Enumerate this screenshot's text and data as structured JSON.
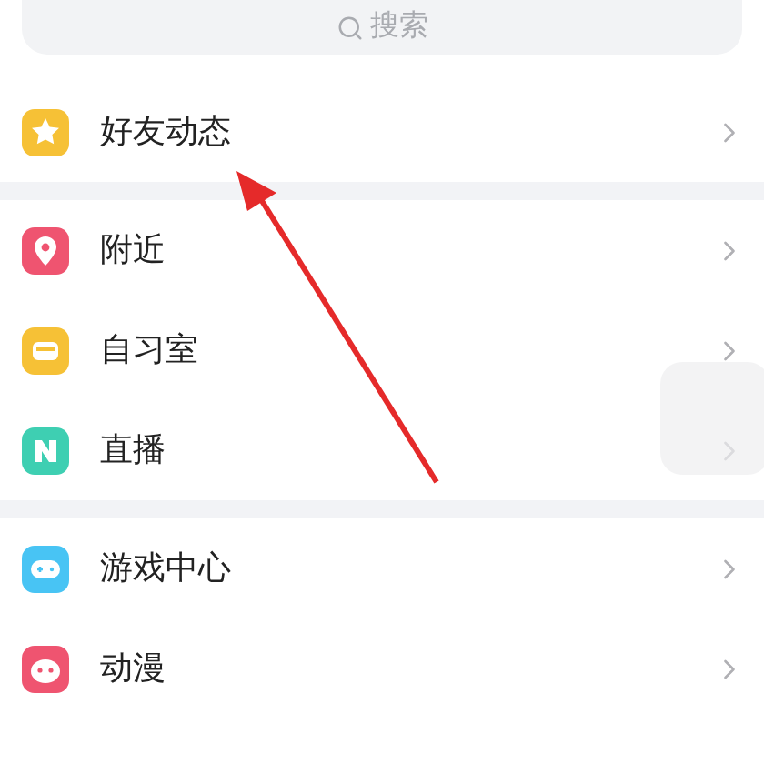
{
  "search": {
    "placeholder": "搜索"
  },
  "sections": [
    {
      "items": [
        {
          "label": "好友动态",
          "color": "#f6c136"
        }
      ]
    },
    {
      "items": [
        {
          "label": "附近",
          "color": "#ef5470"
        },
        {
          "label": "自习室",
          "color": "#f6c136"
        },
        {
          "label": "直播",
          "color": "#3ecfb2"
        }
      ]
    },
    {
      "items": [
        {
          "label": "游戏中心",
          "color": "#48c4f4"
        },
        {
          "label": "动漫",
          "color": "#ef5470"
        }
      ]
    }
  ]
}
